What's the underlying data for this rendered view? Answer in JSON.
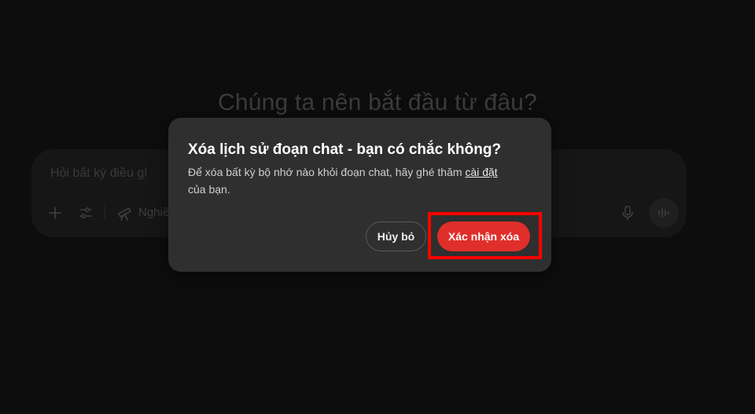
{
  "background": {
    "heading": "Chúng ta nên bắt đầu từ đâu?",
    "composer": {
      "placeholder": "Hỏi bất kỳ điều gì",
      "tool_label": "Nghiê",
      "icons": [
        "plus-icon",
        "sliders-icon",
        "telescope-icon",
        "microphone-icon",
        "voice-wave-icon"
      ]
    }
  },
  "dialog": {
    "title": "Xóa lịch sử đoạn chat - bạn có chắc không?",
    "body_prefix": "Để xóa bất kỳ bộ nhớ nào khỏi đoạn chat, hãy ghé thăm ",
    "body_link": "cài đặt",
    "body_suffix": "của bạn.",
    "cancel_label": "Hủy bỏ",
    "confirm_label": "Xác nhận xóa"
  },
  "colors": {
    "page_bg": "#0d0d0d",
    "modal_bg": "#2f2f2f",
    "confirm_button": "#e02e2a",
    "highlight": "#ff0000"
  }
}
